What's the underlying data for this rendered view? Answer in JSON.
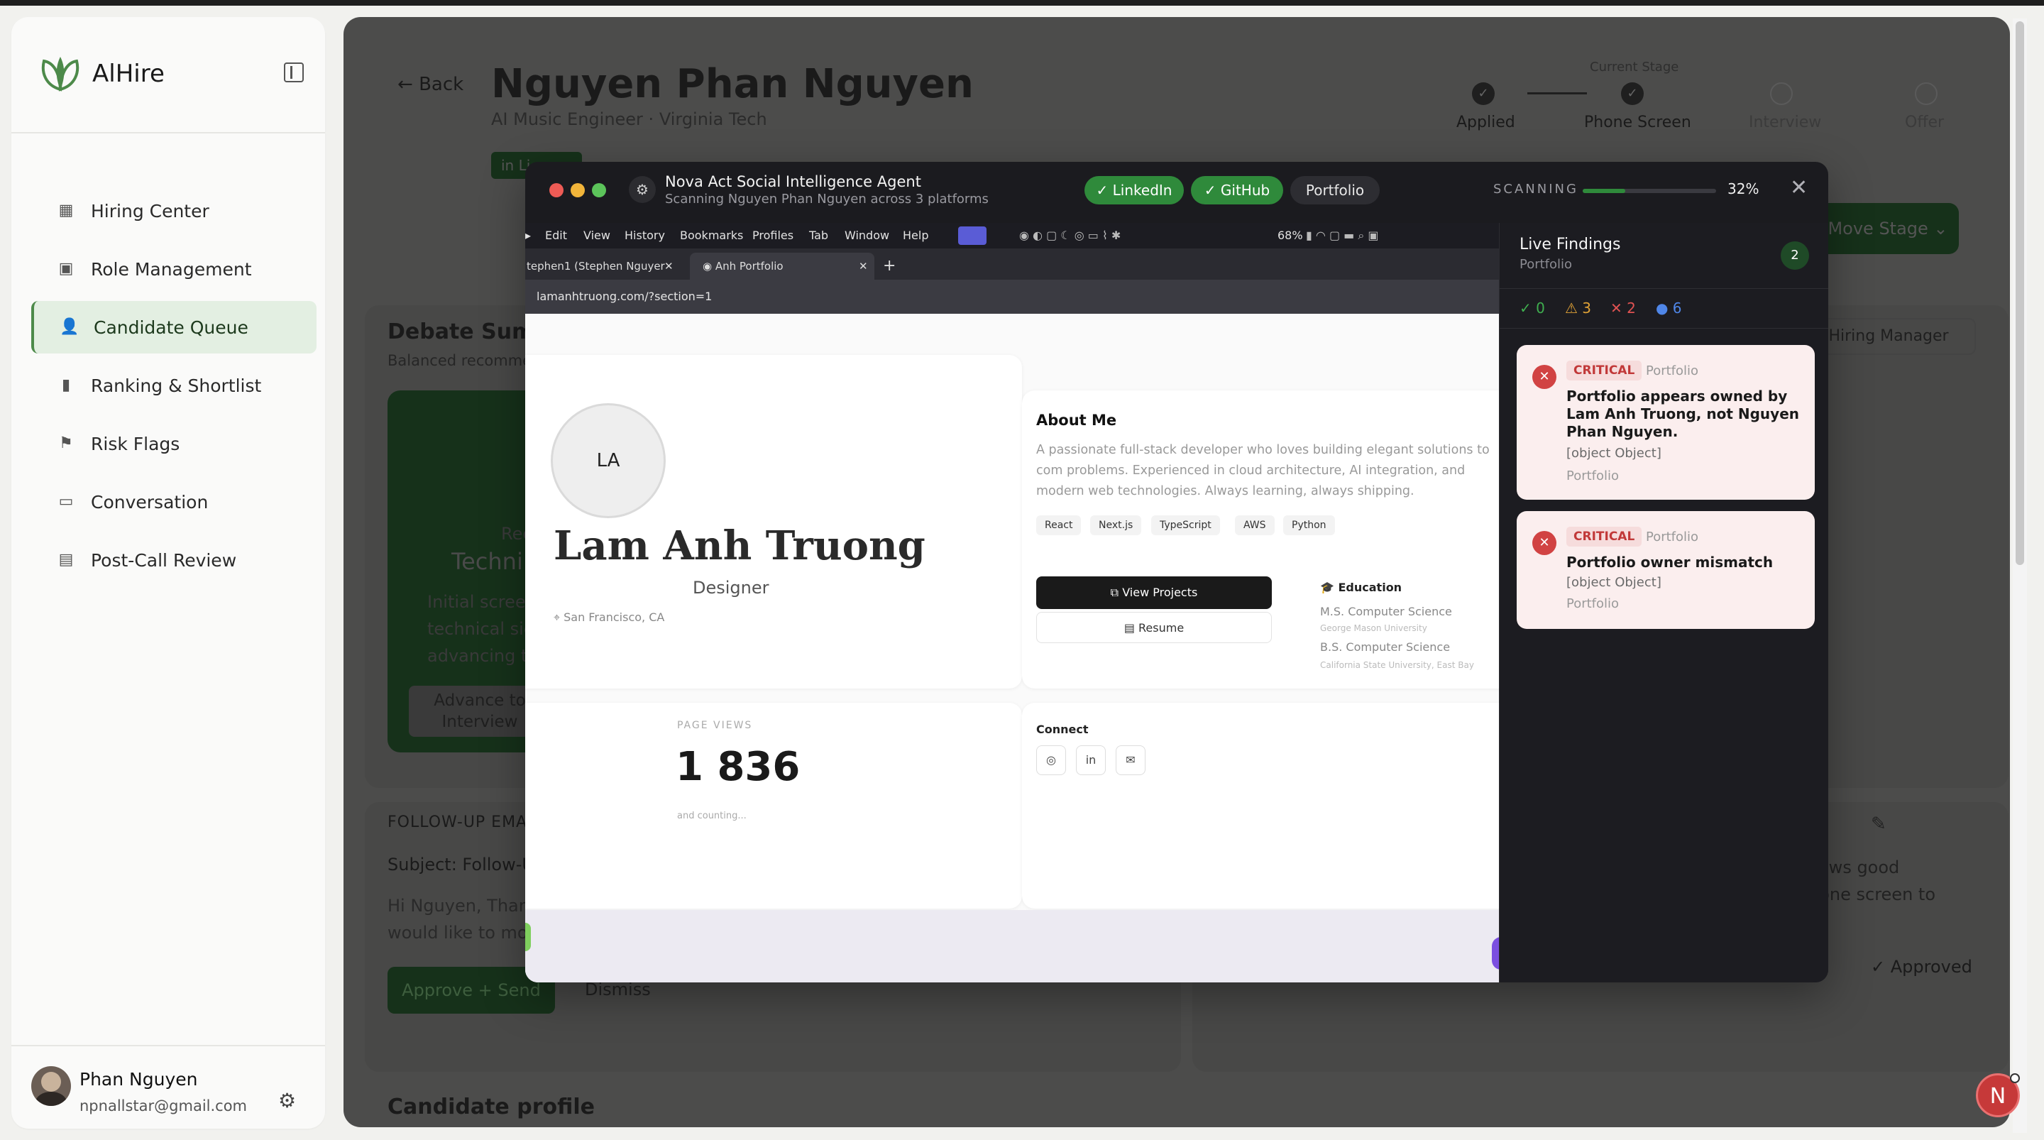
{
  "sidebar": {
    "brand": "AlHire",
    "nav": [
      {
        "label": "Hiring Center",
        "icon": "building-icon"
      },
      {
        "label": "Role Management",
        "icon": "briefcase-icon"
      },
      {
        "label": "Candidate Queue",
        "icon": "users-icon",
        "active": true
      },
      {
        "label": "Ranking & Shortlist",
        "icon": "bar-chart-icon"
      },
      {
        "label": "Risk Flags",
        "icon": "flag-icon"
      },
      {
        "label": "Conversation",
        "icon": "chat-icon"
      },
      {
        "label": "Post-Call Review",
        "icon": "clipboard-icon"
      }
    ],
    "user": {
      "name": "Phan Nguyen",
      "email": "npnallstar@gmail.com"
    }
  },
  "main": {
    "back": "Back",
    "candidate_name": "Nguyen Phan Nguyen",
    "subtitle": "AI Music Engineer · Virginia Tech",
    "linkedin_chip": "in Li",
    "current_stage_label": "Current Stage",
    "stages": [
      "Applied",
      "Phone Screen",
      "Interview",
      "Offer"
    ],
    "move_stage": "Move Stage",
    "debate_title": "Debate Summ",
    "debate_sub": "Balanced recomme",
    "recommend_label": "Recomm",
    "recommend_value": "Techni",
    "rec_text": [
      "Initial screen",
      "technical sig",
      "advancing to"
    ],
    "advance_button": "Advance to Interview",
    "hiring_manager": "o Hiring Manager",
    "followup_label": "FOLLOW-UP EMA",
    "subject": "Subject: Follow-U",
    "body_line1": "Hi Nguyen, Thank",
    "body_line2": "would like to mov",
    "right_text1": "ows good",
    "right_text2": "hone screen to",
    "approve_send": "Approve + Send",
    "dismiss": "Dismiss",
    "approved": "✓ Approved",
    "candidate_profile": "Candidate profile"
  },
  "modal": {
    "title": "Nova Act Social Intelligence Agent",
    "subtitle": "Scanning Nguyen Phan Nguyen across 3 platforms",
    "pills": [
      {
        "label": "✓ LinkedIn",
        "state": "done"
      },
      {
        "label": "✓ GitHub",
        "state": "done"
      },
      {
        "label": "Portfolio",
        "state": "active"
      }
    ],
    "scanning_label": "SCANNING",
    "progress": 0.32,
    "progress_text": "32%"
  },
  "browser": {
    "menu": [
      "Edit",
      "View",
      "History",
      "Bookmarks",
      "Profiles",
      "Tab",
      "Window",
      "Help"
    ],
    "battery": "68%",
    "tabs": [
      "tephen1 (Stephen Nguyer",
      "Anh Portfolio"
    ],
    "url": "lamanhtruong.com/?section=1",
    "portfolio": {
      "initials": "LA",
      "name": "Lam Anh Truong",
      "role": "Designer",
      "location": "San Francisco, CA",
      "about_title": "About Me",
      "about_text": "A passionate full-stack developer who loves building elegant solutions to com problems. Experienced in cloud architecture, AI integration, and modern web technologies. Always learning, always shipping.",
      "skills": [
        "React",
        "Next.js",
        "TypeScript",
        "AWS",
        "Python"
      ],
      "view_projects": "View Projects",
      "resume": "Resume",
      "education_title": "Education",
      "edu1": "M.S. Computer Science",
      "edu1_school": "George Mason University",
      "edu2": "B.S. Computer Science",
      "edu2_school": "California State University, East Bay",
      "page_views_label": "PAGE VIEWS",
      "page_views": "1 836",
      "page_views_sub": "and counting...",
      "connect_title": "Connect"
    }
  },
  "findings": {
    "title": "Live Findings",
    "subtitle": "Portfolio",
    "count": "2",
    "stats": [
      {
        "label": "✓ 0",
        "color": "#3fae4f"
      },
      {
        "label": "⚠ 3",
        "color": "#e0a236"
      },
      {
        "label": "✕ 2",
        "color": "#e05252"
      },
      {
        "label": "● 6",
        "color": "#4f86e8"
      }
    ],
    "items": [
      {
        "severity": "CRITICAL",
        "source": "Portfolio",
        "title": "Portfolio appears owned by Lam Anh Truong, not Nguyen Phan Nguyen.",
        "detail": "[object Object]",
        "footer": "Portfolio"
      },
      {
        "severity": "CRITICAL",
        "source": "Portfolio",
        "title": "Portfolio owner mismatch",
        "detail": "[object Object]",
        "footer": "Portfolio"
      }
    ]
  },
  "fab": {
    "label": "N"
  }
}
